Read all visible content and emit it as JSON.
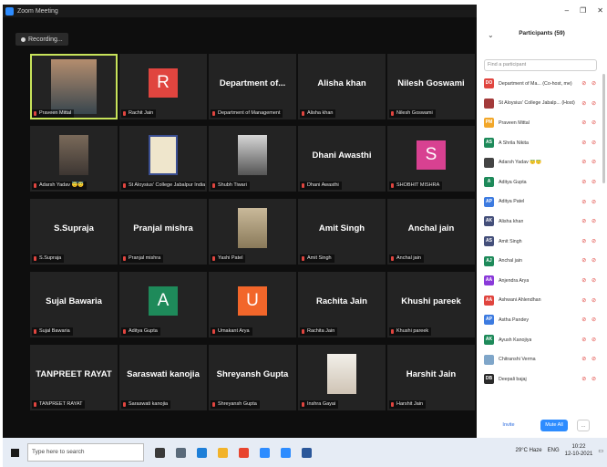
{
  "window": {
    "title": "Zoom Meeting"
  },
  "recording": {
    "label": "Recording..."
  },
  "tiles": [
    {
      "label": "Praveen Mittal",
      "kind": "photo",
      "style": "wide",
      "active": true
    },
    {
      "label": "Rachit Jain",
      "kind": "avatar",
      "letter": "R",
      "color": "#e0453f"
    },
    {
      "label": "Department of Management",
      "kind": "name",
      "display": "Department of..."
    },
    {
      "label": "Alisha khan",
      "kind": "name",
      "display": "Alisha khan"
    },
    {
      "label": "Nilesh Goswami",
      "kind": "name",
      "display": "Nilesh Goswami"
    },
    {
      "label": "Adarsh Yadav 😇😇",
      "kind": "photo",
      "style": "dark"
    },
    {
      "label": "St Aloysius' College Jabalpur India",
      "kind": "photo",
      "style": "logo"
    },
    {
      "label": "Shubh Tiwari",
      "kind": "photo",
      "style": "bw"
    },
    {
      "label": "Dhani Awasthi",
      "kind": "name",
      "display": "Dhani Awasthi"
    },
    {
      "label": "SHOBHIT MISHRA",
      "kind": "avatar",
      "letter": "S",
      "color": "#d84191"
    },
    {
      "label": "S.Supraja",
      "kind": "name",
      "display": "S.Supraja"
    },
    {
      "label": "Pranjal mishra",
      "kind": "name",
      "display": "Pranjal mishra"
    },
    {
      "label": "Yashi Patel",
      "kind": "photo",
      "style": "tan"
    },
    {
      "label": "Amit Singh",
      "kind": "name",
      "display": "Amit Singh"
    },
    {
      "label": "Anchal jain",
      "kind": "name",
      "display": "Anchal jain"
    },
    {
      "label": "Sujal Bawaria",
      "kind": "name",
      "display": "Sujal Bawaria"
    },
    {
      "label": "Aditya Gupta",
      "kind": "avatar",
      "letter": "A",
      "color": "#1e8a5a"
    },
    {
      "label": "Umakant Arya",
      "kind": "avatar",
      "letter": "U",
      "color": "#f2662a"
    },
    {
      "label": "Rachita Jain",
      "kind": "name",
      "display": "Rachita Jain"
    },
    {
      "label": "Khushi pareek",
      "kind": "name",
      "display": "Khushi pareek"
    },
    {
      "label": "TANPREET RAYAT",
      "kind": "name",
      "display": "TANPREET RAYAT"
    },
    {
      "label": "Saraswati kanojia",
      "kind": "name",
      "display": "Saraswati kanojia"
    },
    {
      "label": "Shreyansh Gupta",
      "kind": "name",
      "display": "Shreyansh Gupta"
    },
    {
      "label": "Inshra Gayai",
      "kind": "photo",
      "style": "pale"
    },
    {
      "label": "Harshit Jain",
      "kind": "name",
      "display": "Harshit Jain"
    }
  ],
  "panel": {
    "title": "Participants (59)",
    "search_placeholder": "Find a participant",
    "participants": [
      {
        "initials": "DO",
        "color": "#e0453f",
        "name": "Department of Ma... (Co-host, me)"
      },
      {
        "initials": "",
        "color": "#a33a3a",
        "name": "St Aloysius' College Jabalp... (Host)"
      },
      {
        "initials": "PM",
        "color": "#f2a72a",
        "name": "Praveen Mittal"
      },
      {
        "initials": "AS",
        "color": "#1e8a5a",
        "name": "A Shrila Nikita"
      },
      {
        "initials": "",
        "color": "#444444",
        "name": "Adarsh Yadav 😇😇"
      },
      {
        "initials": "A",
        "color": "#1e8a5a",
        "name": "Aditya Gupta"
      },
      {
        "initials": "AP",
        "color": "#3d7be0",
        "name": "Aditya Patel"
      },
      {
        "initials": "AK",
        "color": "#444f7a",
        "name": "Alisha khan"
      },
      {
        "initials": "AS",
        "color": "#444f7a",
        "name": "Amit Singh"
      },
      {
        "initials": "AJ",
        "color": "#1e8a5a",
        "name": "Anchal jain"
      },
      {
        "initials": "AA",
        "color": "#8a3ad9",
        "name": "Anjendra Arya"
      },
      {
        "initials": "AA",
        "color": "#e0453f",
        "name": "Ashwani Ahlendhan"
      },
      {
        "initials": "AP",
        "color": "#3d7be0",
        "name": "Astha Pandey"
      },
      {
        "initials": "AK",
        "color": "#1e8a5a",
        "name": "Ayush Kanojiya"
      },
      {
        "initials": "",
        "color": "#7fa6c9",
        "name": "Chitranshi Verma"
      },
      {
        "initials": "DB",
        "color": "#2a2a2a",
        "name": "Deepali bajaj"
      }
    ],
    "invite_label": "Invite",
    "mute_all_label": "Mute All",
    "more_label": "..."
  },
  "taskbar": {
    "search_placeholder": "Type here to search",
    "weather": "29°C Haze",
    "language": "ENG",
    "time": "10:22",
    "date": "12-10-2021"
  }
}
